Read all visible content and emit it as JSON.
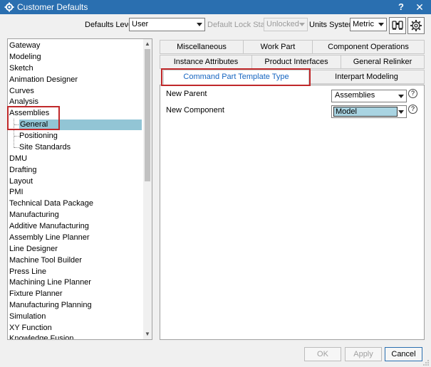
{
  "window": {
    "title": "Customer Defaults",
    "help": "?",
    "close": "✕"
  },
  "toolbar": {
    "defaults_level_label": "Defaults Level",
    "defaults_level_value": "User",
    "lock_state_label": "Default Lock State",
    "lock_state_value": "Unlocked",
    "units_label": "Units System",
    "units_value": "Metric"
  },
  "tree": {
    "items": [
      "Gateway",
      "Modeling",
      "Sketch",
      "Animation Designer",
      "Curves",
      "Analysis",
      "Assemblies",
      "General",
      "Positioning",
      "Site Standards",
      "DMU",
      "Drafting",
      "Layout",
      "PMI",
      "Technical Data Package",
      "Manufacturing",
      "Additive Manufacturing",
      "Assembly Line Planner",
      "Line Designer",
      "Machine Tool Builder",
      "Press Line",
      "Machining Line Planner",
      "Fixture Planner",
      "Manufacturing Planning",
      "Simulation",
      "XY Function",
      "Knowledge Fusion"
    ]
  },
  "tabs": {
    "row1": [
      "Miscellaneous",
      "Work Part",
      "Component Operations"
    ],
    "row2": [
      "Instance Attributes",
      "Product Interfaces",
      "General Relinker"
    ],
    "row3": [
      "Command Part Template Type",
      "Interpart Modeling"
    ]
  },
  "panel": {
    "new_parent_label": "New Parent",
    "new_parent_value": "Assemblies",
    "new_component_label": "New Component",
    "new_component_value": "Model",
    "help": "?"
  },
  "footer": {
    "ok": "OK",
    "apply": "Apply",
    "cancel": "Cancel"
  },
  "colors": {
    "title_bar": "#2a6fb0",
    "selection": "#92c5d5",
    "highlight_box": "#c0282a",
    "active_tab_text": "#1565c0"
  }
}
